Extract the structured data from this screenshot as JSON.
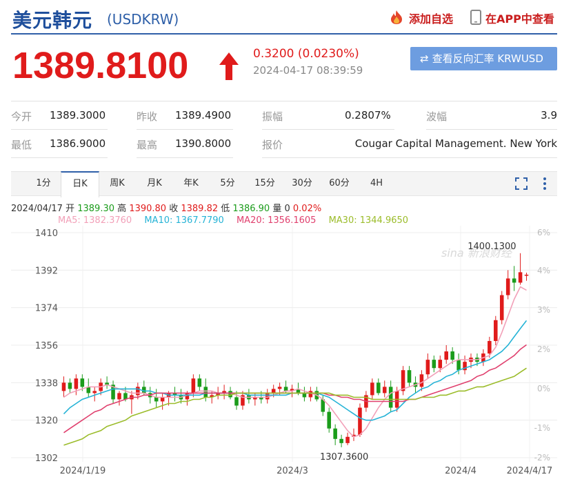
{
  "header": {
    "title": "美元韩元",
    "code": "(USDKRW)",
    "favorite_label": "添加自选",
    "app_label": "在APP中查看",
    "accent_color": "#1f4f9c",
    "alert_color": "#c91d1d"
  },
  "quote": {
    "price": "1389.8100",
    "change": "0.3200 (0.0230%)",
    "timestamp": "2024-04-17 08:39:59",
    "reverse_button": "查看反向汇率 KRWUSD",
    "up_color": "#e01b1b"
  },
  "stats": {
    "open_label": "今开",
    "open": "1389.3000",
    "prev_close_label": "昨收",
    "prev_close": "1389.4900",
    "amplitude_label": "振幅",
    "amplitude": "0.2807%",
    "wave_label": "波幅",
    "wave": "3.9",
    "low_label": "最低",
    "low": "1386.9000",
    "high_label": "最高",
    "high": "1390.8000",
    "quoter_label": "报价",
    "quoter": "Cougar Capital Management. New York"
  },
  "tabs": [
    "1分",
    "日K",
    "周K",
    "月K",
    "年K",
    "5分",
    "15分",
    "30分",
    "60分",
    "4H"
  ],
  "active_tab": "日K",
  "ohlc_line": {
    "date": "2024/04/17",
    "open_label": "开",
    "open": "1389.30",
    "high_label": "高",
    "high": "1390.80",
    "close_label": "收",
    "close": "1389.82",
    "low_label": "低",
    "low": "1386.90",
    "volume_label": "量",
    "volume": "0",
    "pct": "0.02%"
  },
  "ma_line": {
    "ma5": "MA5: 1382.3760",
    "ma10": "MA10: 1367.7790",
    "ma20": "MA20: 1356.1605",
    "ma30": "MA30: 1344.9650",
    "ma5_color": "#f2a0b8",
    "ma10_color": "#25b3d6",
    "ma20_color": "#e0406e",
    "ma30_color": "#9bbc2a"
  },
  "watermark": "sina 新浪财经",
  "chart_data": {
    "type": "candlestick",
    "y_ticks": [
      "1410",
      "1392",
      "1374",
      "1356",
      "1338",
      "1320",
      "1302"
    ],
    "ylim": [
      1302,
      1410
    ],
    "pct_ticks": [
      "6%",
      "4%",
      "3%",
      "2%",
      "0%",
      "-1%",
      "-2%"
    ],
    "x_ticks": [
      "2024/1/19",
      "2024/3",
      "2024/4",
      "2024/4/17"
    ],
    "annotations": [
      "1400.1300",
      "1307.3600"
    ],
    "up_color": "#e01b1b",
    "down_color": "#1b9c1b",
    "candles": [
      [
        1334,
        1341,
        1331,
        1338
      ],
      [
        1338,
        1340,
        1333,
        1335
      ],
      [
        1335,
        1342,
        1332,
        1340
      ],
      [
        1340,
        1342,
        1334,
        1336
      ],
      [
        1336,
        1340,
        1331,
        1333
      ],
      [
        1333,
        1336,
        1329,
        1334
      ],
      [
        1334,
        1340,
        1332,
        1338
      ],
      [
        1338,
        1341,
        1335,
        1337
      ],
      [
        1337,
        1339,
        1328,
        1330
      ],
      [
        1330,
        1334,
        1327,
        1333
      ],
      [
        1333,
        1336,
        1329,
        1330
      ],
      [
        1330,
        1334,
        1323,
        1332
      ],
      [
        1332,
        1338,
        1330,
        1336
      ],
      [
        1336,
        1339,
        1332,
        1333
      ],
      [
        1333,
        1336,
        1328,
        1331
      ],
      [
        1331,
        1335,
        1326,
        1329
      ],
      [
        1329,
        1333,
        1325,
        1331
      ],
      [
        1331,
        1334,
        1327,
        1333
      ],
      [
        1333,
        1336,
        1329,
        1332
      ],
      [
        1332,
        1335,
        1328,
        1330
      ],
      [
        1330,
        1334,
        1327,
        1333
      ],
      [
        1333,
        1342,
        1331,
        1340
      ],
      [
        1340,
        1342,
        1334,
        1336
      ],
      [
        1336,
        1340,
        1329,
        1331
      ],
      [
        1331,
        1334,
        1328,
        1332
      ],
      [
        1332,
        1336,
        1330,
        1333
      ],
      [
        1333,
        1337,
        1330,
        1334
      ],
      [
        1334,
        1336,
        1330,
        1331
      ],
      [
        1331,
        1334,
        1325,
        1327
      ],
      [
        1327,
        1334,
        1325,
        1332
      ],
      [
        1332,
        1335,
        1328,
        1330
      ],
      [
        1330,
        1333,
        1327,
        1331
      ],
      [
        1331,
        1334,
        1328,
        1330
      ],
      [
        1330,
        1335,
        1328,
        1333
      ],
      [
        1333,
        1337,
        1331,
        1335
      ],
      [
        1335,
        1338,
        1332,
        1336
      ],
      [
        1336,
        1339,
        1333,
        1334
      ],
      [
        1334,
        1337,
        1331,
        1335
      ],
      [
        1335,
        1338,
        1332,
        1333
      ],
      [
        1333,
        1336,
        1329,
        1331
      ],
      [
        1331,
        1336,
        1329,
        1334
      ],
      [
        1334,
        1336,
        1329,
        1330
      ],
      [
        1330,
        1332,
        1322,
        1324
      ],
      [
        1324,
        1326,
        1314,
        1316
      ],
      [
        1316,
        1318,
        1308,
        1311
      ],
      [
        1311,
        1313,
        1307,
        1309
      ],
      [
        1309,
        1314,
        1308,
        1312
      ],
      [
        1312,
        1316,
        1310,
        1313
      ],
      [
        1313,
        1328,
        1312,
        1326
      ],
      [
        1326,
        1334,
        1324,
        1332
      ],
      [
        1332,
        1340,
        1330,
        1338
      ],
      [
        1338,
        1340,
        1332,
        1333
      ],
      [
        1333,
        1339,
        1331,
        1336
      ],
      [
        1336,
        1339,
        1324,
        1326
      ],
      [
        1326,
        1336,
        1324,
        1334
      ],
      [
        1334,
        1346,
        1332,
        1344
      ],
      [
        1344,
        1346,
        1336,
        1338
      ],
      [
        1338,
        1341,
        1333,
        1336
      ],
      [
        1336,
        1344,
        1334,
        1342
      ],
      [
        1342,
        1352,
        1340,
        1349
      ],
      [
        1349,
        1351,
        1343,
        1345
      ],
      [
        1345,
        1351,
        1343,
        1349
      ],
      [
        1349,
        1356,
        1347,
        1353
      ],
      [
        1353,
        1355,
        1347,
        1349
      ],
      [
        1349,
        1352,
        1342,
        1344
      ],
      [
        1344,
        1351,
        1342,
        1348
      ],
      [
        1348,
        1352,
        1345,
        1350
      ],
      [
        1350,
        1352,
        1346,
        1348
      ],
      [
        1348,
        1354,
        1346,
        1352
      ],
      [
        1352,
        1360,
        1350,
        1358
      ],
      [
        1358,
        1370,
        1356,
        1368
      ],
      [
        1368,
        1382,
        1366,
        1380
      ],
      [
        1380,
        1392,
        1378,
        1388
      ],
      [
        1388,
        1394,
        1382,
        1386
      ],
      [
        1386,
        1400.13,
        1385,
        1391
      ],
      [
        1389.3,
        1390.8,
        1386.9,
        1389.82
      ]
    ],
    "series": [
      {
        "name": "MA5",
        "color": "#f2a0b8",
        "values": [
          1331,
          1333,
          1334,
          1335,
          1336,
          1336,
          1336,
          1337,
          1336,
          1335,
          1334,
          1333,
          1333,
          1333,
          1332,
          1331,
          1331,
          1331,
          1331,
          1331,
          1332,
          1333,
          1334,
          1334,
          1334,
          1333,
          1333,
          1333,
          1332,
          1331,
          1331,
          1331,
          1331,
          1331,
          1332,
          1333,
          1334,
          1334,
          1335,
          1334,
          1333,
          1332,
          1330,
          1327,
          1323,
          1319,
          1315,
          1312,
          1313,
          1316,
          1321,
          1326,
          1330,
          1333,
          1334,
          1335,
          1336,
          1337,
          1338,
          1340,
          1342,
          1344,
          1346,
          1348,
          1349,
          1349,
          1349,
          1349,
          1350,
          1351,
          1355,
          1362,
          1370,
          1378,
          1384,
          1382.376
        ]
      },
      {
        "name": "MA10",
        "color": "#25b3d6",
        "values": [
          1323,
          1326,
          1328,
          1330,
          1331,
          1332,
          1333,
          1334,
          1335,
          1335,
          1335,
          1335,
          1335,
          1334,
          1334,
          1333,
          1333,
          1332,
          1332,
          1332,
          1332,
          1332,
          1332,
          1333,
          1333,
          1333,
          1333,
          1333,
          1333,
          1333,
          1332,
          1332,
          1332,
          1332,
          1332,
          1332,
          1332,
          1333,
          1333,
          1333,
          1333,
          1333,
          1332,
          1331,
          1329,
          1327,
          1325,
          1323,
          1321,
          1320,
          1320,
          1321,
          1322,
          1324,
          1325,
          1328,
          1331,
          1333,
          1335,
          1336,
          1338,
          1339,
          1341,
          1342,
          1344,
          1345,
          1346,
          1347,
          1348,
          1349,
          1351,
          1353,
          1356,
          1360,
          1364,
          1367.779
        ]
      },
      {
        "name": "MA20",
        "color": "#e0406e",
        "values": [
          1314,
          1316,
          1318,
          1320,
          1322,
          1324,
          1325,
          1327,
          1328,
          1329,
          1330,
          1331,
          1331,
          1332,
          1332,
          1333,
          1333,
          1333,
          1333,
          1333,
          1333,
          1333,
          1333,
          1333,
          1333,
          1333,
          1333,
          1333,
          1333,
          1333,
          1333,
          1333,
          1333,
          1333,
          1333,
          1333,
          1333,
          1333,
          1333,
          1333,
          1333,
          1333,
          1333,
          1332,
          1332,
          1331,
          1331,
          1330,
          1330,
          1329,
          1329,
          1329,
          1329,
          1329,
          1329,
          1329,
          1330,
          1330,
          1331,
          1332,
          1333,
          1334,
          1335,
          1336,
          1337,
          1338,
          1339,
          1341,
          1342,
          1344,
          1345,
          1347,
          1349,
          1351,
          1354,
          1356.1605
        ]
      },
      {
        "name": "MA30",
        "color": "#9bbc2a",
        "values": [
          1308,
          1309,
          1310,
          1311,
          1313,
          1314,
          1315,
          1317,
          1318,
          1319,
          1320,
          1322,
          1323,
          1324,
          1325,
          1326,
          1327,
          1328,
          1328,
          1329,
          1329,
          1330,
          1330,
          1331,
          1331,
          1332,
          1332,
          1332,
          1333,
          1333,
          1333,
          1333,
          1333,
          1333,
          1333,
          1333,
          1333,
          1333,
          1333,
          1333,
          1333,
          1333,
          1333,
          1333,
          1332,
          1332,
          1332,
          1331,
          1331,
          1331,
          1330,
          1330,
          1330,
          1330,
          1330,
          1330,
          1330,
          1330,
          1331,
          1331,
          1331,
          1332,
          1332,
          1333,
          1334,
          1334,
          1335,
          1336,
          1336,
          1337,
          1338,
          1339,
          1340,
          1341,
          1343,
          1344.965
        ]
      }
    ]
  }
}
